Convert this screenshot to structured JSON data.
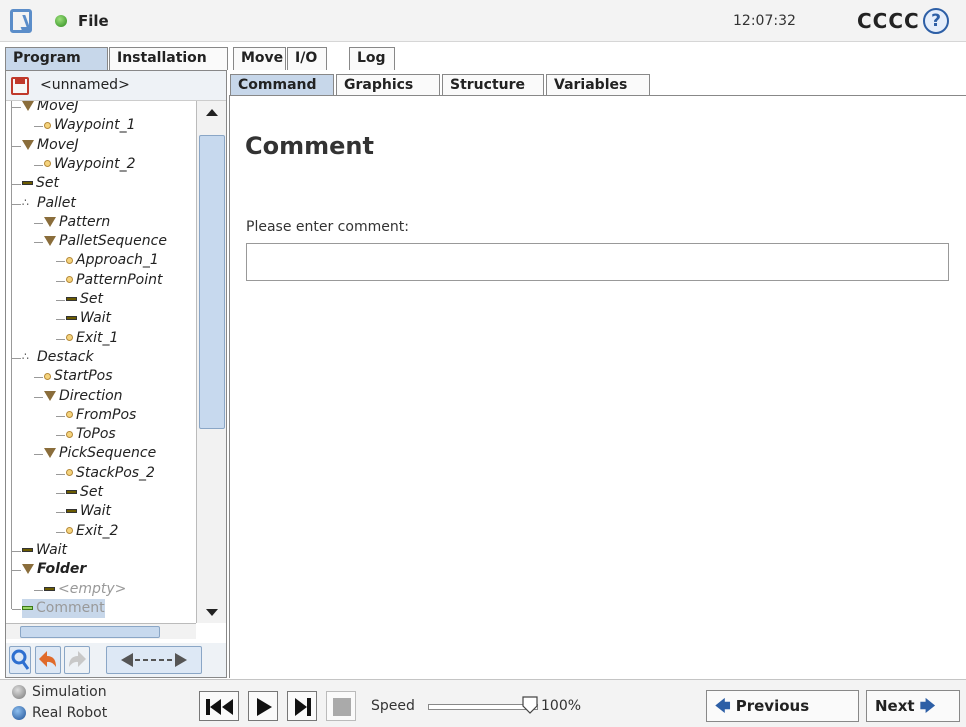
{
  "header": {
    "file_menu": "File",
    "clock": "12:07:32",
    "robot_name": "CCCC",
    "help": "?"
  },
  "main_tabs": [
    {
      "label": "Program",
      "active": true
    },
    {
      "label": "Installation",
      "active": false
    },
    {
      "label": "Move",
      "active": false
    },
    {
      "label": "I/O",
      "active": false
    },
    {
      "label": "Log",
      "active": false
    }
  ],
  "program_name": "<unnamed>",
  "sub_tabs": [
    {
      "label": "Command",
      "active": true
    },
    {
      "label": "Graphics",
      "active": false
    },
    {
      "label": "Structure",
      "active": false
    },
    {
      "label": "Variables",
      "active": false
    }
  ],
  "tree": [
    {
      "label": "MoveJ",
      "icon": "movej-icon",
      "indent": 0
    },
    {
      "label": "Waypoint_1",
      "icon": "waypoint-icon",
      "indent": 1
    },
    {
      "label": "MoveJ",
      "icon": "movej-icon",
      "indent": 0
    },
    {
      "label": "Waypoint_2",
      "icon": "waypoint-icon",
      "indent": 1
    },
    {
      "label": "Set",
      "icon": "set-icon",
      "indent": 0
    },
    {
      "label": "Pallet",
      "icon": "pallet-icon",
      "indent": 0
    },
    {
      "label": "Pattern",
      "icon": "pattern-icon",
      "indent": 1
    },
    {
      "label": "PalletSequence",
      "icon": "sequence-icon",
      "indent": 1
    },
    {
      "label": "Approach_1",
      "icon": "waypoint-icon",
      "indent": 2
    },
    {
      "label": "PatternPoint",
      "icon": "waypoint-icon",
      "indent": 2
    },
    {
      "label": "Set",
      "icon": "set-icon",
      "indent": 2
    },
    {
      "label": "Wait",
      "icon": "wait-icon",
      "indent": 2
    },
    {
      "label": "Exit_1",
      "icon": "waypoint-icon",
      "indent": 2
    },
    {
      "label": "Destack",
      "icon": "destack-icon",
      "indent": 0
    },
    {
      "label": "StartPos",
      "icon": "waypoint-icon",
      "indent": 1
    },
    {
      "label": "Direction",
      "icon": "direction-icon",
      "indent": 1
    },
    {
      "label": "FromPos",
      "icon": "waypoint-icon",
      "indent": 2
    },
    {
      "label": "ToPos",
      "icon": "waypoint-icon",
      "indent": 2
    },
    {
      "label": "PickSequence",
      "icon": "sequence-icon",
      "indent": 1
    },
    {
      "label": "StackPos_2",
      "icon": "waypoint-icon",
      "indent": 2
    },
    {
      "label": "Set",
      "icon": "set-icon",
      "indent": 2
    },
    {
      "label": "Wait",
      "icon": "wait-icon",
      "indent": 2
    },
    {
      "label": "Exit_2",
      "icon": "waypoint-icon",
      "indent": 2
    },
    {
      "label": "Wait",
      "icon": "wait-icon",
      "indent": 0
    },
    {
      "label": "Folder",
      "icon": "folder-icon",
      "indent": 0
    },
    {
      "label": "<empty>",
      "icon": "empty-icon",
      "indent": 1
    },
    {
      "label": "Comment",
      "icon": "comment-icon",
      "indent": 0
    }
  ],
  "command": {
    "title": "Comment",
    "prompt": "Please enter comment:",
    "value": "",
    "placeholder": ""
  },
  "footer": {
    "simulation": "Simulation",
    "real_robot": "Real Robot",
    "speed_label": "Speed",
    "speed_value": "100%",
    "speed_fraction": 1.0,
    "previous": "Previous",
    "next": "Next"
  }
}
